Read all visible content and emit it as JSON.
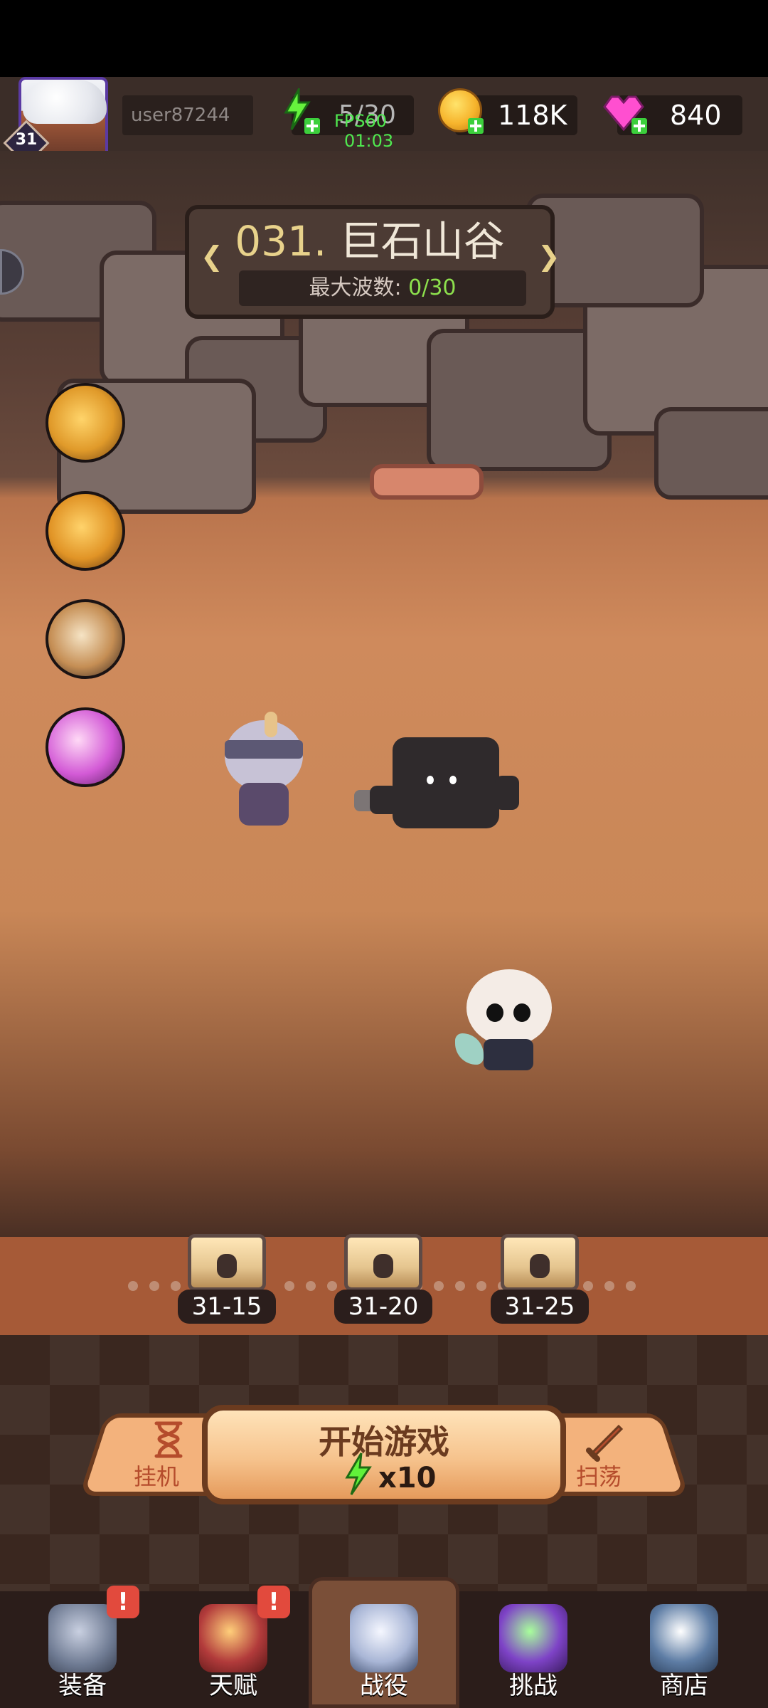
{
  "header": {
    "level": "31",
    "username": "user87244",
    "energy": "5/30",
    "fps_label": "FPS60",
    "timer": "01:03",
    "coins": "118K",
    "gems": "840"
  },
  "stage": {
    "title_number": "031.",
    "title_name": "巨石山谷",
    "subtitle_label": "最大波数:",
    "subtitle_value": "0/30"
  },
  "progress_chests": [
    {
      "label": "31-15"
    },
    {
      "label": "31-20"
    },
    {
      "label": "31-25"
    }
  ],
  "actions": {
    "idle_label": "挂机",
    "start_label": "开始游戏",
    "start_cost": "x10",
    "sweep_label": "扫荡"
  },
  "bottom_nav": {
    "items": [
      {
        "label": "装备",
        "badge": "!"
      },
      {
        "label": "天赋",
        "badge": "!"
      },
      {
        "label": "战役",
        "badge": ""
      },
      {
        "label": "挑战",
        "badge": ""
      },
      {
        "label": "商店",
        "badge": ""
      }
    ],
    "active_index": 2
  },
  "colors": {
    "accent_green": "#4fe84f",
    "badge_red": "#e24a3d",
    "banner_gold": "#e8d28b"
  }
}
